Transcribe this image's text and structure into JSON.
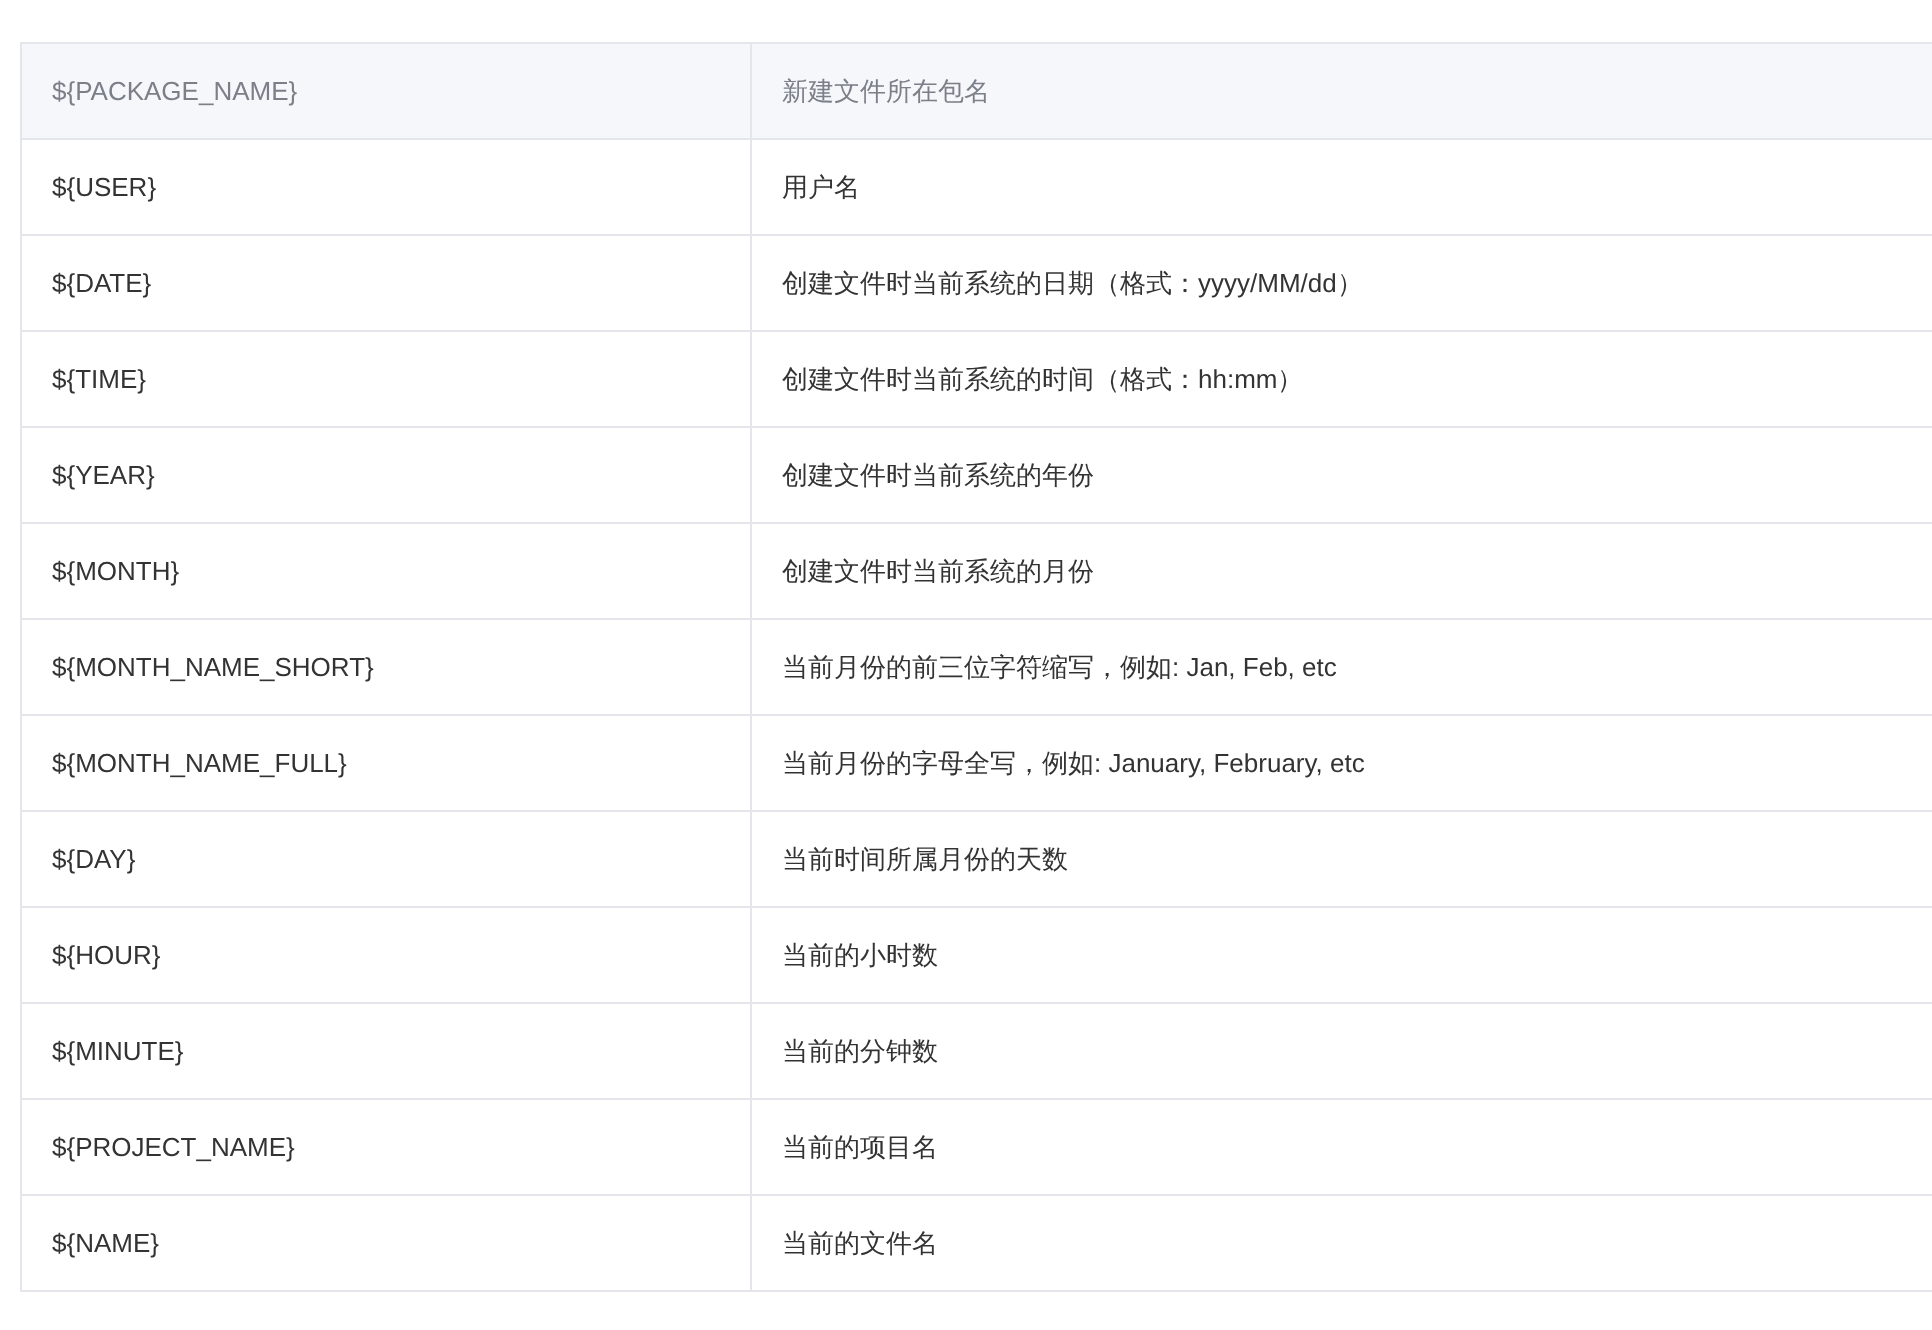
{
  "table": {
    "header": [
      "${PACKAGE_NAME}",
      "新建文件所在包名"
    ],
    "rows": [
      [
        "${USER}",
        "用户名"
      ],
      [
        "${DATE}",
        "创建文件时当前系统的日期（格式：yyyy/MM/dd）"
      ],
      [
        "${TIME}",
        "创建文件时当前系统的时间（格式：hh:mm）"
      ],
      [
        "${YEAR}",
        "创建文件时当前系统的年份"
      ],
      [
        "${MONTH}",
        "创建文件时当前系统的月份"
      ],
      [
        "${MONTH_NAME_SHORT}",
        "当前月份的前三位字符缩写，例如: Jan, Feb, etc"
      ],
      [
        "${MONTH_NAME_FULL}",
        "当前月份的字母全写，例如: January, February, etc"
      ],
      [
        "${DAY}",
        "当前时间所属月份的天数"
      ],
      [
        "${HOUR}",
        "当前的小时数"
      ],
      [
        "${MINUTE}",
        "当前的分钟数"
      ],
      [
        "${PROJECT_NAME}",
        "当前的项目名"
      ],
      [
        "${NAME}",
        "当前的文件名"
      ]
    ]
  }
}
